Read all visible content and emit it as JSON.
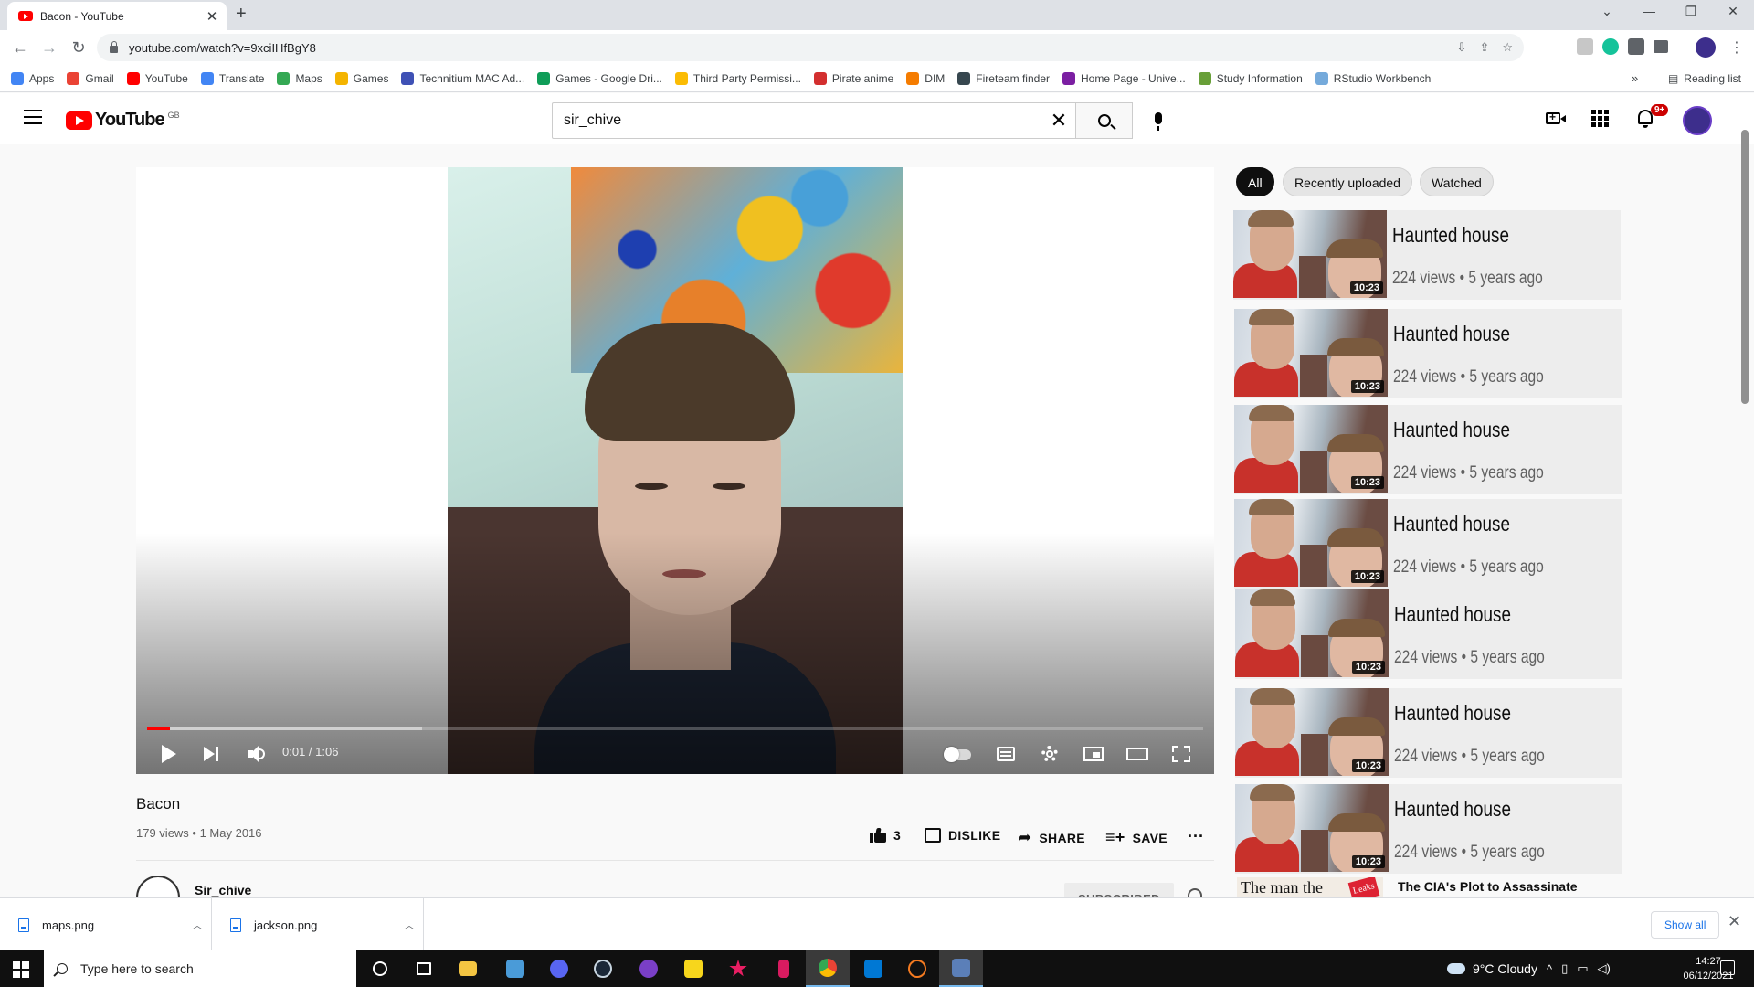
{
  "browser": {
    "tab_title": "Bacon - YouTube",
    "tab_close": "✕",
    "new_tab": "+",
    "window_controls": [
      "⌄",
      "—",
      "❐",
      "✕"
    ],
    "url": "youtube.com/watch?v=9xciIHfBgY8",
    "bookmarks": [
      {
        "label": "Apps",
        "color": "#4285f4"
      },
      {
        "label": "Gmail",
        "color": "#ea4335"
      },
      {
        "label": "YouTube",
        "color": "#ff0000"
      },
      {
        "label": "Translate",
        "color": "#4285f4"
      },
      {
        "label": "Maps",
        "color": "#34a853"
      },
      {
        "label": "Games",
        "color": "#f4b400"
      },
      {
        "label": "Technitium MAC Ad...",
        "color": "#3f51b5"
      },
      {
        "label": "Games - Google Dri...",
        "color": "#0f9d58"
      },
      {
        "label": "Third Party Permissi...",
        "color": "#fbbc04"
      },
      {
        "label": "Pirate anime",
        "color": "#d32f2f"
      },
      {
        "label": "DIM",
        "color": "#f57c00"
      },
      {
        "label": "Fireteam finder",
        "color": "#37474f"
      },
      {
        "label": "Home Page - Unive...",
        "color": "#7b1fa2"
      },
      {
        "label": "Study Information",
        "color": "#689f38"
      },
      {
        "label": "RStudio Workbench",
        "color": "#75aadb"
      }
    ],
    "bookmarks_overflow": "»",
    "reading_list": "Reading list"
  },
  "youtube": {
    "logo_text": "YouTube",
    "region": "GB",
    "search_value": "sir_chive",
    "notifications_badge": "9+"
  },
  "player": {
    "time": "0:01 / 1:06",
    "played_fraction": 0.022,
    "loaded_fraction": 0.26
  },
  "video": {
    "title": "Bacon",
    "meta": "179 views • 1 May 2016",
    "likes": "3",
    "dislike_label": "DISLIKE",
    "share_label": "SHARE",
    "save_label": "SAVE",
    "more": "...",
    "channel": "Sir_chive",
    "subscribed_label": "SUBSCRIBED"
  },
  "sidebar": {
    "chips": [
      "All",
      "Recently uploaded",
      "Watched"
    ],
    "recommendations": [
      {
        "title": "Haunted house",
        "meta": "224 views • 5 years ago",
        "duration": "10:23"
      },
      {
        "title": "Haunted house",
        "meta": "224 views • 5 years ago",
        "duration": "10:23"
      },
      {
        "title": "Haunted house",
        "meta": "224 views • 5 years ago",
        "duration": "10:23"
      },
      {
        "title": "Haunted house",
        "meta": "224 views • 5 years ago",
        "duration": "10:23"
      },
      {
        "title": "Haunted house",
        "meta": "224 views • 5 years ago",
        "duration": "10:23"
      },
      {
        "title": "Haunted house",
        "meta": "224 views • 5 years ago",
        "duration": "10:23"
      },
      {
        "title": "Haunted house",
        "meta": "224 views • 5 years ago",
        "duration": "10:23"
      }
    ],
    "last_item": {
      "thumb_text": "The man the",
      "thumb_badge": "Leaks",
      "title": "The CIA's Plot to Assassinate"
    }
  },
  "downloads": {
    "items": [
      "maps.png",
      "jackson.png"
    ],
    "show_all": "Show all",
    "close": "✕"
  },
  "taskbar": {
    "search_placeholder": "Type here to search",
    "weather": "9°C  Cloudy",
    "time": "14:27",
    "date": "06/12/2021"
  }
}
